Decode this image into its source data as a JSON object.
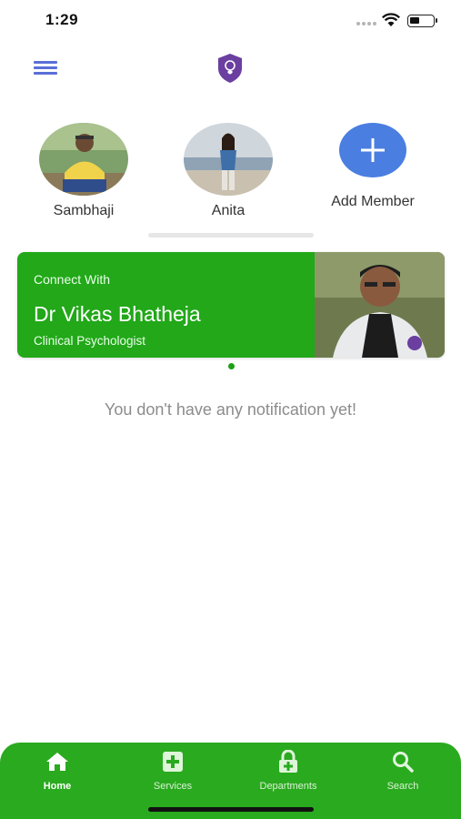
{
  "status_bar": {
    "time": "1:29"
  },
  "members": [
    {
      "name": "Sambhaji"
    },
    {
      "name": "Anita"
    }
  ],
  "add_member_label": "Add Member",
  "banner": {
    "eyebrow": "Connect With",
    "doctor_name": "Dr Vikas Bhatheja",
    "specialty": "Clinical Psychologist"
  },
  "empty_message": "You don't have any notification yet!",
  "nav": {
    "items": [
      {
        "label": "Home",
        "icon": "home-icon",
        "active": true
      },
      {
        "label": "Services",
        "icon": "plus-box-icon",
        "active": false
      },
      {
        "label": "Departments",
        "icon": "lock-plus-icon",
        "active": false
      },
      {
        "label": "Search",
        "icon": "search-icon",
        "active": false
      }
    ]
  },
  "colors": {
    "brand_green": "#22a819",
    "accent_blue": "#4a7ee0",
    "logo_purple": "#6a3fa0"
  }
}
